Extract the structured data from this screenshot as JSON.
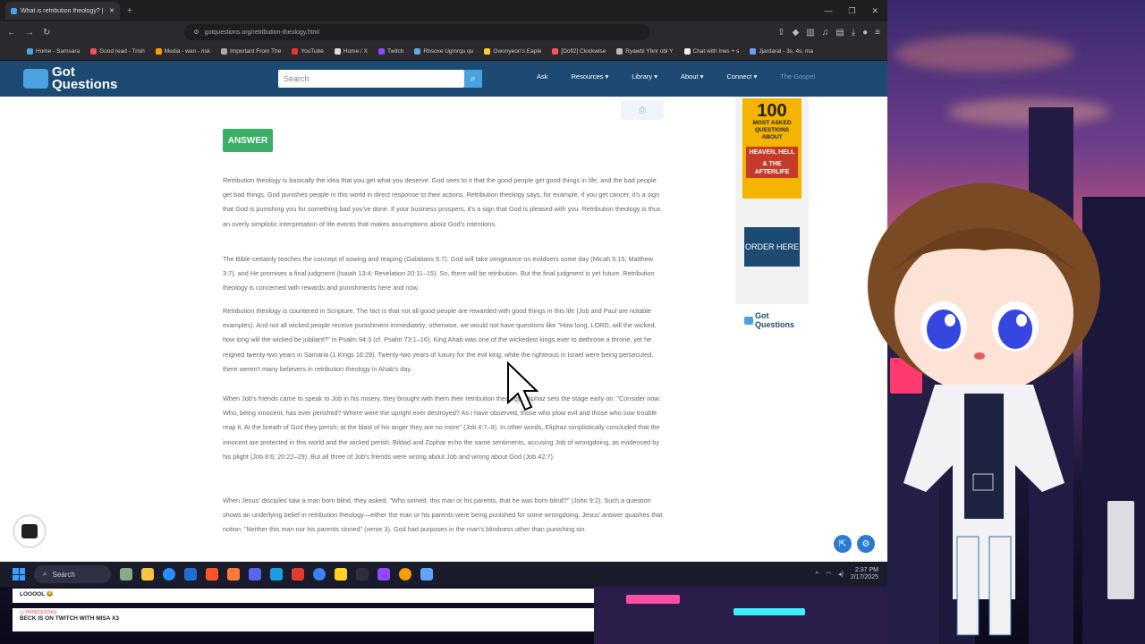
{
  "browser": {
    "tab_title": "What is retribution theology? | G",
    "url": "gotquestions.org/retribution-theology.html",
    "bookmarks": [
      "Home - Samsara",
      "Good read - Trish",
      "Media - wan - risk",
      "Important From The",
      "YouTube",
      "Home / X",
      "Twitch",
      "Rbsoxe Ugmrqu qu",
      "Gwonyeon's Eapie",
      "[Dofl2] Clockwise",
      "Ryawbl Ybnr obl Y",
      "Chat with Ines + s",
      "Jjardaral - 3s, 4s, ma"
    ]
  },
  "site": {
    "logo_line1": "Got",
    "logo_line2": "Questions",
    "search_placeholder": "Search",
    "nav": [
      {
        "label": "Ask"
      },
      {
        "label": "Resources ▾"
      },
      {
        "label": "Library ▾"
      },
      {
        "label": "About ▾"
      },
      {
        "label": "Connect ▾"
      },
      {
        "label": "The Gospel"
      }
    ]
  },
  "article": {
    "answer_label": "ANSWER",
    "paragraphs": [
      "Retribution theology is basically the idea that you get what you deserve. God sees to it that the good people get good things in life, and the bad people get bad things. God punishes people in this world in direct response to their actions. Retribution theology says, for example, if you get cancer, it's a sign that God is punishing you for something bad you've done. If your business prospers, it's a sign that God is pleased with you. Retribution theology is thus an overly simplistic interpretation of life events that makes assumptions about God's intentions.",
      "The Bible certainly teaches the concept of sowing and reaping (Galatians 6:7). God will take vengeance on evildoers some day (Micah 5:15; Matthew 3:7), and He promises a final judgment (Isaiah 13:4; Revelation 20:11–15). So, there will be retribution. But the final judgment is yet future. Retribution theology is concerned with rewards and punishments here and now.",
      "Retribution theology is countered in Scripture. The fact is that not all good people are rewarded with good things in this life (Job and Paul are notable examples). And not all wicked people receive punishment immediately; otherwise, we would not have questions like \"How long, LORD, will the wicked, how long will the wicked be jubilant?\" in Psalm 94:3 (cf. Psalm 73:1–16). King Ahab was one of the wickedest kings ever to dethrone a throne, yet he reigned twenty-two years in Samaria (1 Kings 16:29). Twenty-two years of luxury for the evil king, while the righteous in Israel were being persecuted, there weren't many believers in retribution theology in Ahab's day.",
      "When Job's friends came to speak to Job in his misery, they brought with them their retribution theology. Eliphaz sets the stage early on: \"Consider now: Who, being innocent, has ever perished? Where were the upright ever destroyed? As I have observed, those who plow evil and those who sow trouble reap it. At the breath of God they perish; at the blast of his anger they are no more\" (Job 4:7–9). In other words, Eliphaz simplistically concluded that the innocent are protected in this world and the wicked perish. Bildad and Zophar echo the same sentiments, accusing Job of wrongdoing, as evidenced by his plight (Job 8:6; 20:22–29). But all three of Job's friends were wrong about Job and wrong about God (Job 42:7).",
      "When Jesus' disciples saw a man born blind, they asked, \"Who sinned, this man or his parents, that he was born blind?\" (John 9:2). Such a question shows an underlying belief in retribution theology—either the man or his parents were being punished for some wrongdoing. Jesus' answer quashes that notion: \"Neither this man nor his parents sinned\" (verse 3). God had purposes in the man's blindness other than punishing sin."
    ]
  },
  "sidebar_ad": {
    "book_number": "100",
    "book_line1": "MOST ASKED",
    "book_line2": "QUESTIONS",
    "book_line3": "ABOUT",
    "book_line4": "HEAVEN, HELL",
    "book_line5": "& THE AFTERLIFE",
    "order_label": "ORDER HERE",
    "brand_line1": "Got",
    "brand_line2": "Questions"
  },
  "taskbar": {
    "search_label": "Search",
    "time": "2:37 PM",
    "date": "2/17/2025"
  },
  "chat": [
    {
      "user": "",
      "message": "LOOOOL 😂"
    },
    {
      "user": "◎ PRINCESSKE",
      "message": "BECK IS ON TWITCH WITH MISA X3"
    }
  ],
  "colors": {
    "site_header": "#1c4a72",
    "answer_badge": "#3bae67",
    "link": "#4a8bc2",
    "book": "#f4b400"
  }
}
